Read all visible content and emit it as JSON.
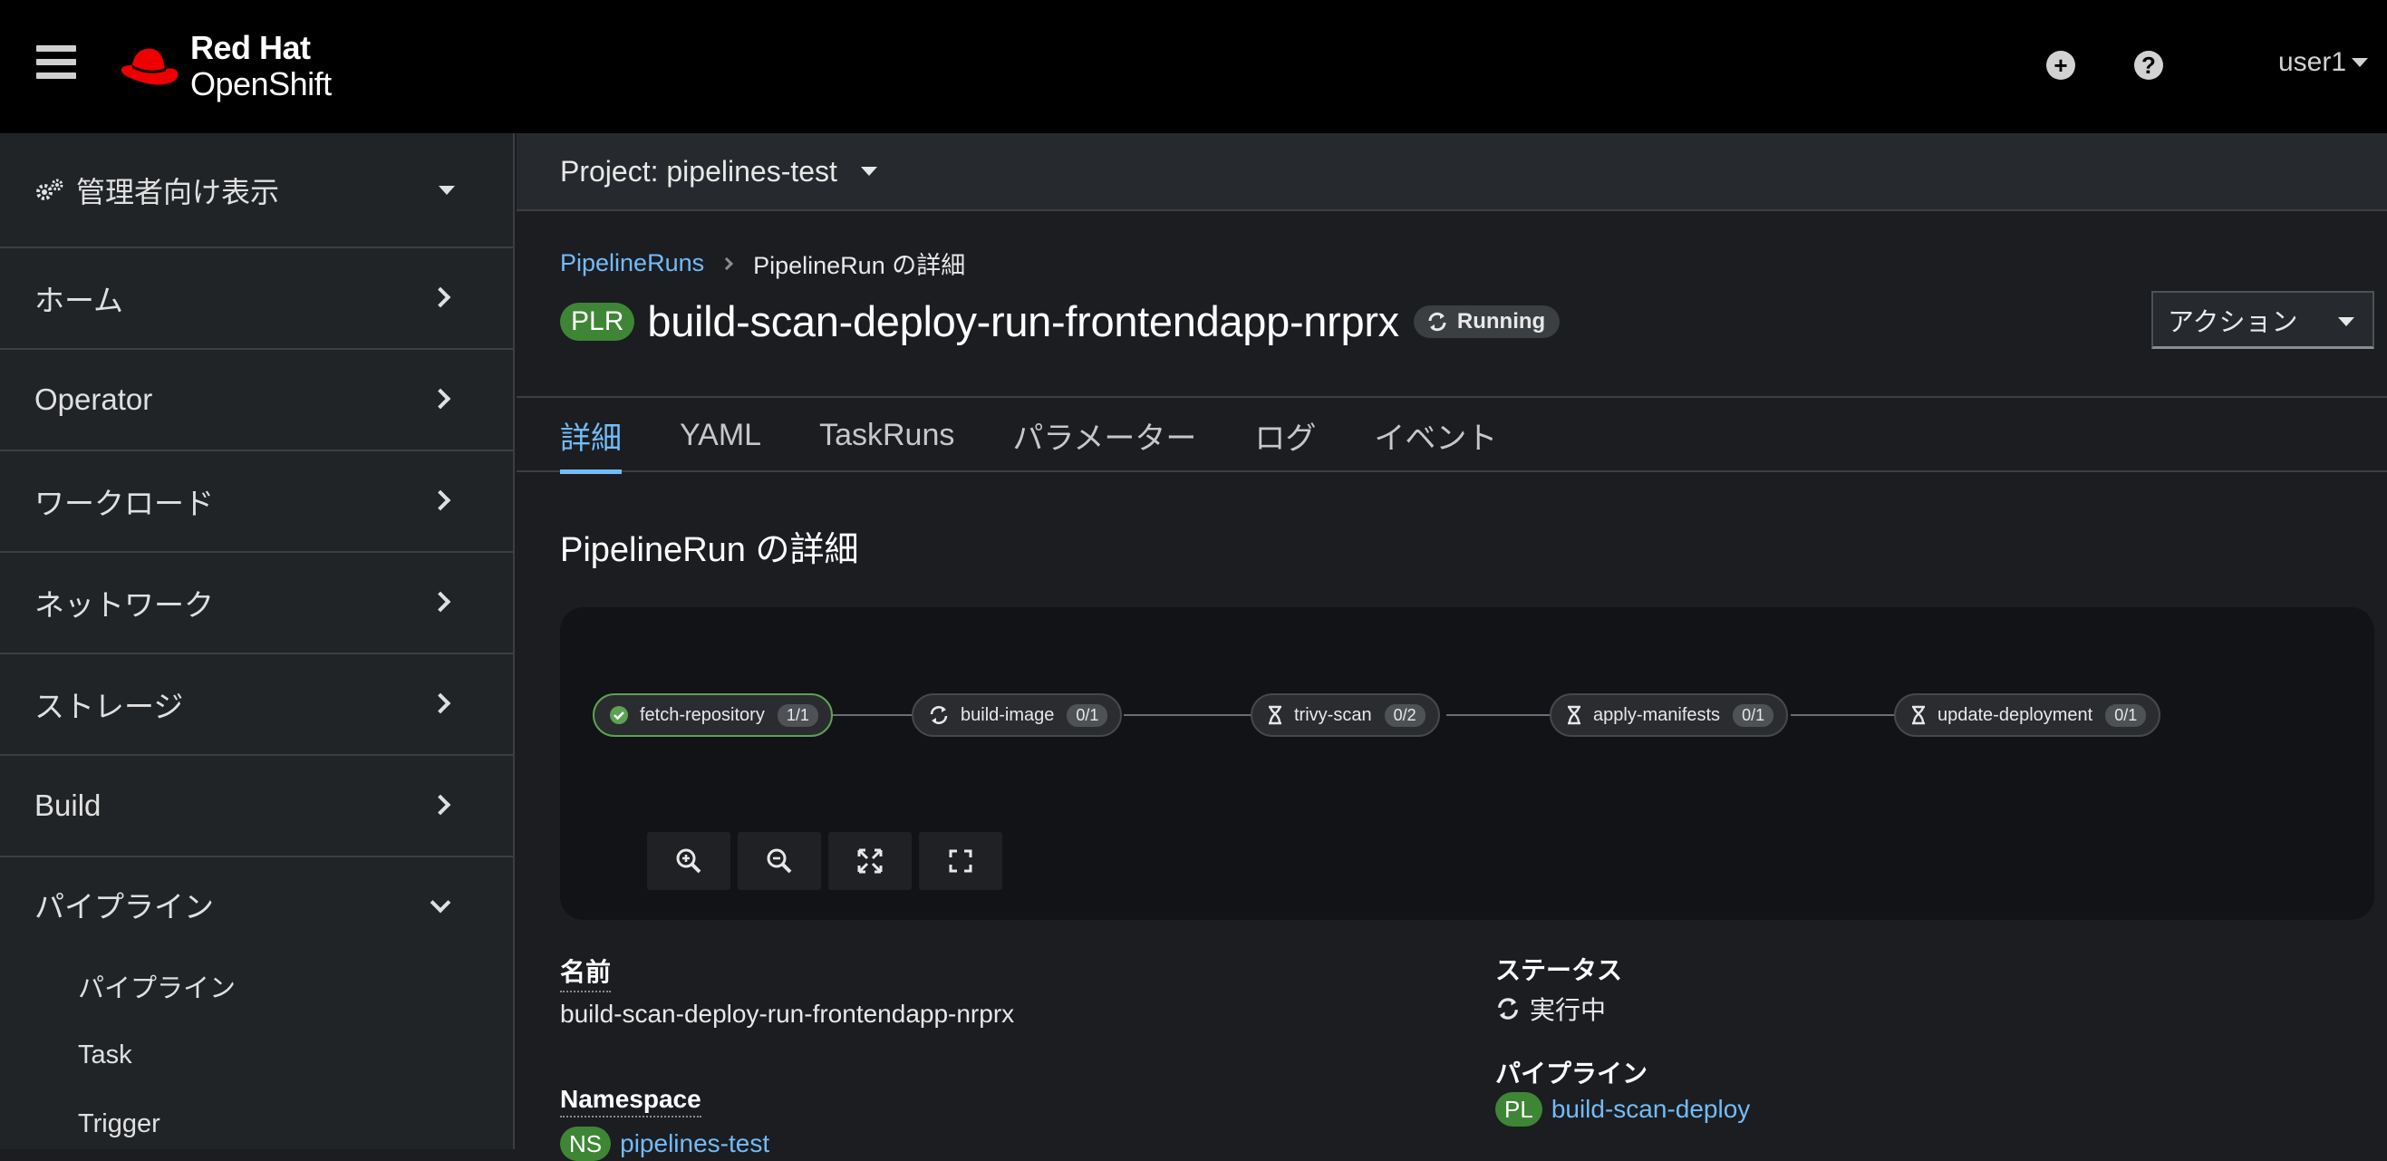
{
  "masthead": {
    "brand_line1": "Red Hat",
    "brand_line2": "OpenShift",
    "user": "user1",
    "add_icon": "plus-circle-icon",
    "help_icon": "question-circle-icon"
  },
  "sidebar": {
    "perspective": "管理者向け表示",
    "items": [
      {
        "label": "ホーム"
      },
      {
        "label": "Operator"
      },
      {
        "label": "ワークロード"
      },
      {
        "label": "ネットワーク"
      },
      {
        "label": "ストレージ"
      },
      {
        "label": "Build"
      },
      {
        "label": "パイプライン"
      }
    ],
    "sub_items": [
      {
        "label": "パイプライン"
      },
      {
        "label": "Task"
      },
      {
        "label": "Trigger"
      }
    ]
  },
  "project_bar": {
    "label": "Project: pipelines-test"
  },
  "breadcrumb": {
    "parent": "PipelineRuns",
    "current": "PipelineRun の詳細"
  },
  "header": {
    "badge": "PLR",
    "title": "build-scan-deploy-run-frontendapp-nrprx",
    "status": "Running",
    "actions_label": "アクション"
  },
  "tabs": [
    {
      "label": "詳細",
      "active": true
    },
    {
      "label": "YAML"
    },
    {
      "label": "TaskRuns"
    },
    {
      "label": "パラメーター"
    },
    {
      "label": "ログ"
    },
    {
      "label": "イベント"
    }
  ],
  "section_title": "PipelineRun の詳細",
  "pipeline_graph": {
    "nodes": [
      {
        "name": "fetch-repository",
        "count": "1/1",
        "state": "succeeded"
      },
      {
        "name": "build-image",
        "count": "0/1",
        "state": "running"
      },
      {
        "name": "trivy-scan",
        "count": "0/2",
        "state": "pending"
      },
      {
        "name": "apply-manifests",
        "count": "0/1",
        "state": "pending"
      },
      {
        "name": "update-deployment",
        "count": "0/1",
        "state": "pending"
      }
    ],
    "colors": {
      "success": "#5ba352",
      "line": "#6a6e73"
    }
  },
  "details": {
    "name_label": "名前",
    "name_value": "build-scan-deploy-run-frontendapp-nrprx",
    "namespace_label": "Namespace",
    "namespace_badge": "NS",
    "namespace_value": "pipelines-test",
    "status_label": "ステータス",
    "status_value": "実行中",
    "pipeline_label": "パイプライン",
    "pipeline_badge": "PL",
    "pipeline_value": "build-scan-deploy"
  }
}
